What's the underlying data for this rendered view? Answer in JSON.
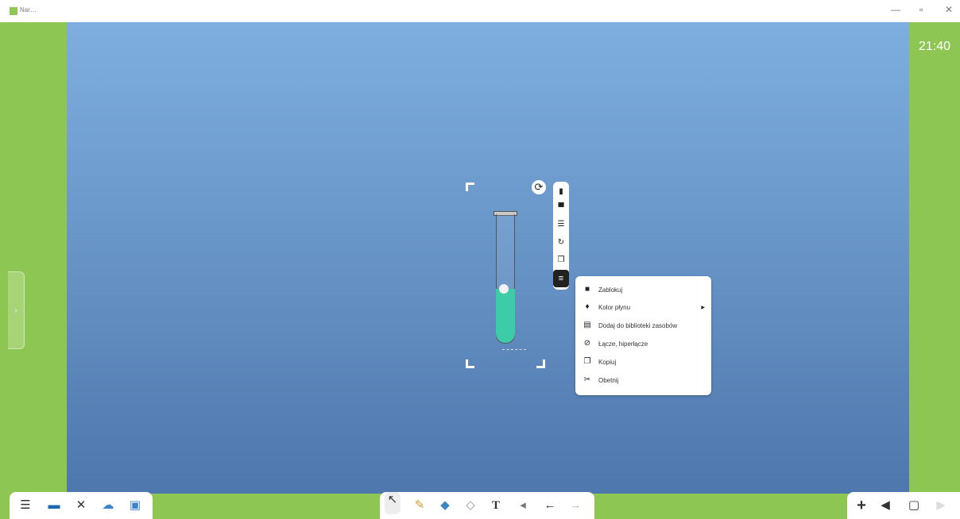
{
  "window": {
    "title": "Nar…",
    "minimize_glyph": "—",
    "restore_glyph": "▫",
    "close_glyph": "✕"
  },
  "clock": "21:40",
  "side_panel_toggle": "›",
  "selection_toolbar": {
    "items": [
      "delete-icon",
      "copy-to-top-icon",
      "align-icon",
      "refresh-icon",
      "duplicate-icon",
      "menu-icon"
    ]
  },
  "context_menu": {
    "items": [
      {
        "label": "Zablokuj",
        "icon": "lock-icon",
        "submenu": false
      },
      {
        "label": "Kolor płynu",
        "icon": "paint-bucket-icon",
        "submenu": true
      },
      {
        "label": "Dodaj do biblioteki zasobów",
        "icon": "library-icon",
        "submenu": false
      },
      {
        "label": "Łącze, hiperłącze",
        "icon": "link-icon",
        "submenu": false
      },
      {
        "label": "Kopiuj",
        "icon": "copy-icon",
        "submenu": false
      },
      {
        "label": "Obetnij",
        "icon": "scissors-icon",
        "submenu": false
      }
    ]
  },
  "bottom_left_tools": [
    "menu-icon",
    "screen-icon",
    "tools-icon",
    "cloud-icon",
    "image-icon"
  ],
  "bottom_center_tools": [
    "select-icon",
    "pen-icon",
    "highlighter-icon",
    "eraser-icon",
    "text-icon",
    "sound-icon",
    "undo-icon",
    "redo-icon"
  ],
  "bottom_right_tools": [
    "add-page-icon",
    "prev-page-icon",
    "pages-icon",
    "next-page-icon"
  ],
  "colors": {
    "frame": "#8dc652",
    "stage_top": "#7eaee0",
    "stage_bottom": "#4e77ad",
    "liquid": "#3dcca8"
  }
}
